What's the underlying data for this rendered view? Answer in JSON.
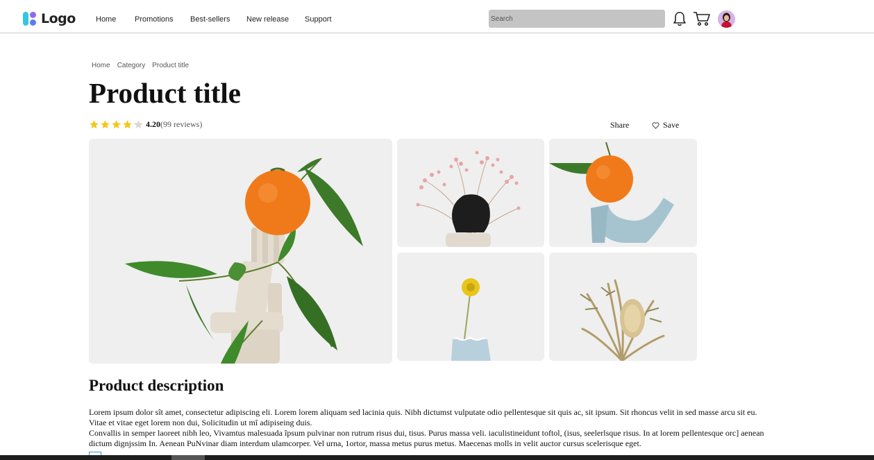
{
  "header": {
    "logo_text": "Logo",
    "nav": [
      "Home",
      "Promotions",
      "Best-sellers",
      "New release",
      "Support"
    ],
    "search_placeholder": "Search"
  },
  "breadcrumb": [
    "Home",
    "Category",
    "Product title"
  ],
  "product": {
    "title": "Product title",
    "rating": "4.20",
    "reviews": "(99 reviews)",
    "rating_value": 4.2,
    "rating_max": 5,
    "share_label": "Share",
    "save_label": "Save"
  },
  "gallery": [
    {
      "name": "main-image-orange-leaves-sculpture"
    },
    {
      "name": "thumb-pink-flowers-black-rock"
    },
    {
      "name": "thumb-orange-blue-sculpture"
    },
    {
      "name": "thumb-yellow-flower-vase"
    },
    {
      "name": "thumb-dried-plants"
    }
  ],
  "description": {
    "heading": "Product description",
    "paragraph1": "Lorem ipsum dolor sît amet, consectetur adipiscing eli. Lorem lorem aliquam sed lacinia quis. Nibh dictumst vulputate odio pellentesque sit quis ac, sit ipsum. Sit rhoncus velit in sed masse arcu sit eu. Vitae et vitae eget lorem non dui, Solicitudin ut mî adipiseing duis.",
    "paragraph2": "Convallis in semper laoreet nibh leo, Vivamtus malesuada îpsum pulvinar non rutrum risus dui, tisus. Purus massa veli. iaculistineidunt toftol, (isus, seelerlsque risus. In at lorem pellentesque orc] aenean dictum dignjssim In. Aenean PuNvinar diam interdum ulamcorper. Vel urna, 1ortor, massa metus purus metus. Maecenas molls in velit auctor cursus scelerisque eget."
  },
  "colors": {
    "star": "#f5c518",
    "search_bg": "#c4c4c4",
    "logo_cyan": "#33c6e0",
    "logo_purple": "#8b6bf2"
  }
}
